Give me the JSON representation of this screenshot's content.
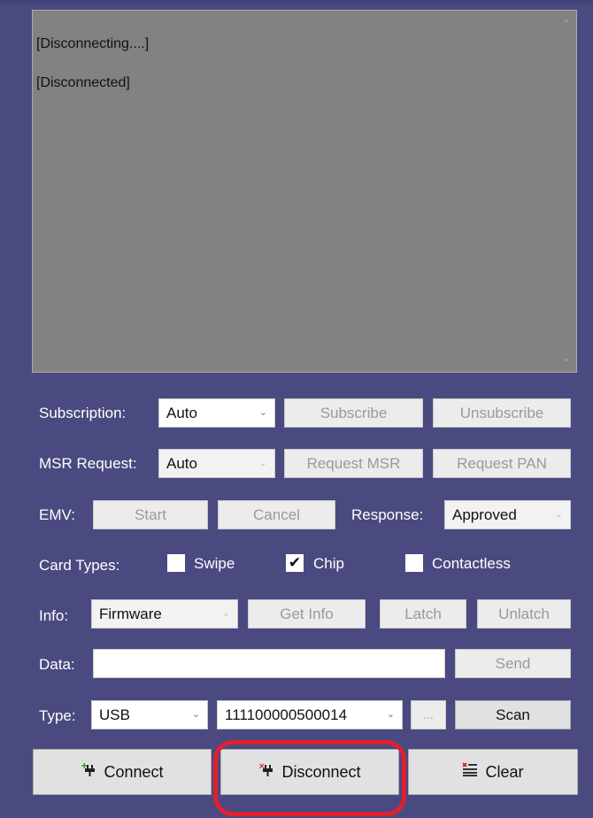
{
  "log": {
    "lines": [
      "[Disconnecting....]",
      "[Disconnected]"
    ]
  },
  "subscription": {
    "label": "Subscription:",
    "value": "Auto",
    "subscribe": "Subscribe",
    "unsubscribe": "Unsubscribe"
  },
  "msr": {
    "label": "MSR Request:",
    "value": "Auto",
    "request_msr": "Request MSR",
    "request_pan": "Request PAN"
  },
  "emv": {
    "label": "EMV:",
    "start": "Start",
    "cancel": "Cancel",
    "response_label": "Response:",
    "response_value": "Approved"
  },
  "card_types": {
    "label": "Card Types:",
    "swipe": {
      "label": "Swipe",
      "checked": false
    },
    "chip": {
      "label": "Chip",
      "checked": true
    },
    "contactless": {
      "label": "Contactless",
      "checked": false
    }
  },
  "info": {
    "label": "Info:",
    "value": "Firmware",
    "get_info": "Get Info",
    "latch": "Latch",
    "unlatch": "Unlatch"
  },
  "data": {
    "label": "Data:",
    "value": "",
    "send": "Send"
  },
  "type": {
    "label": "Type:",
    "value": "USB",
    "device": "111100000500014",
    "browse": "...",
    "scan": "Scan"
  },
  "actions": {
    "connect": "Connect",
    "disconnect": "Disconnect",
    "clear": "Clear"
  },
  "colors": {
    "background": "#4a4a80",
    "highlight": "#e02030"
  }
}
